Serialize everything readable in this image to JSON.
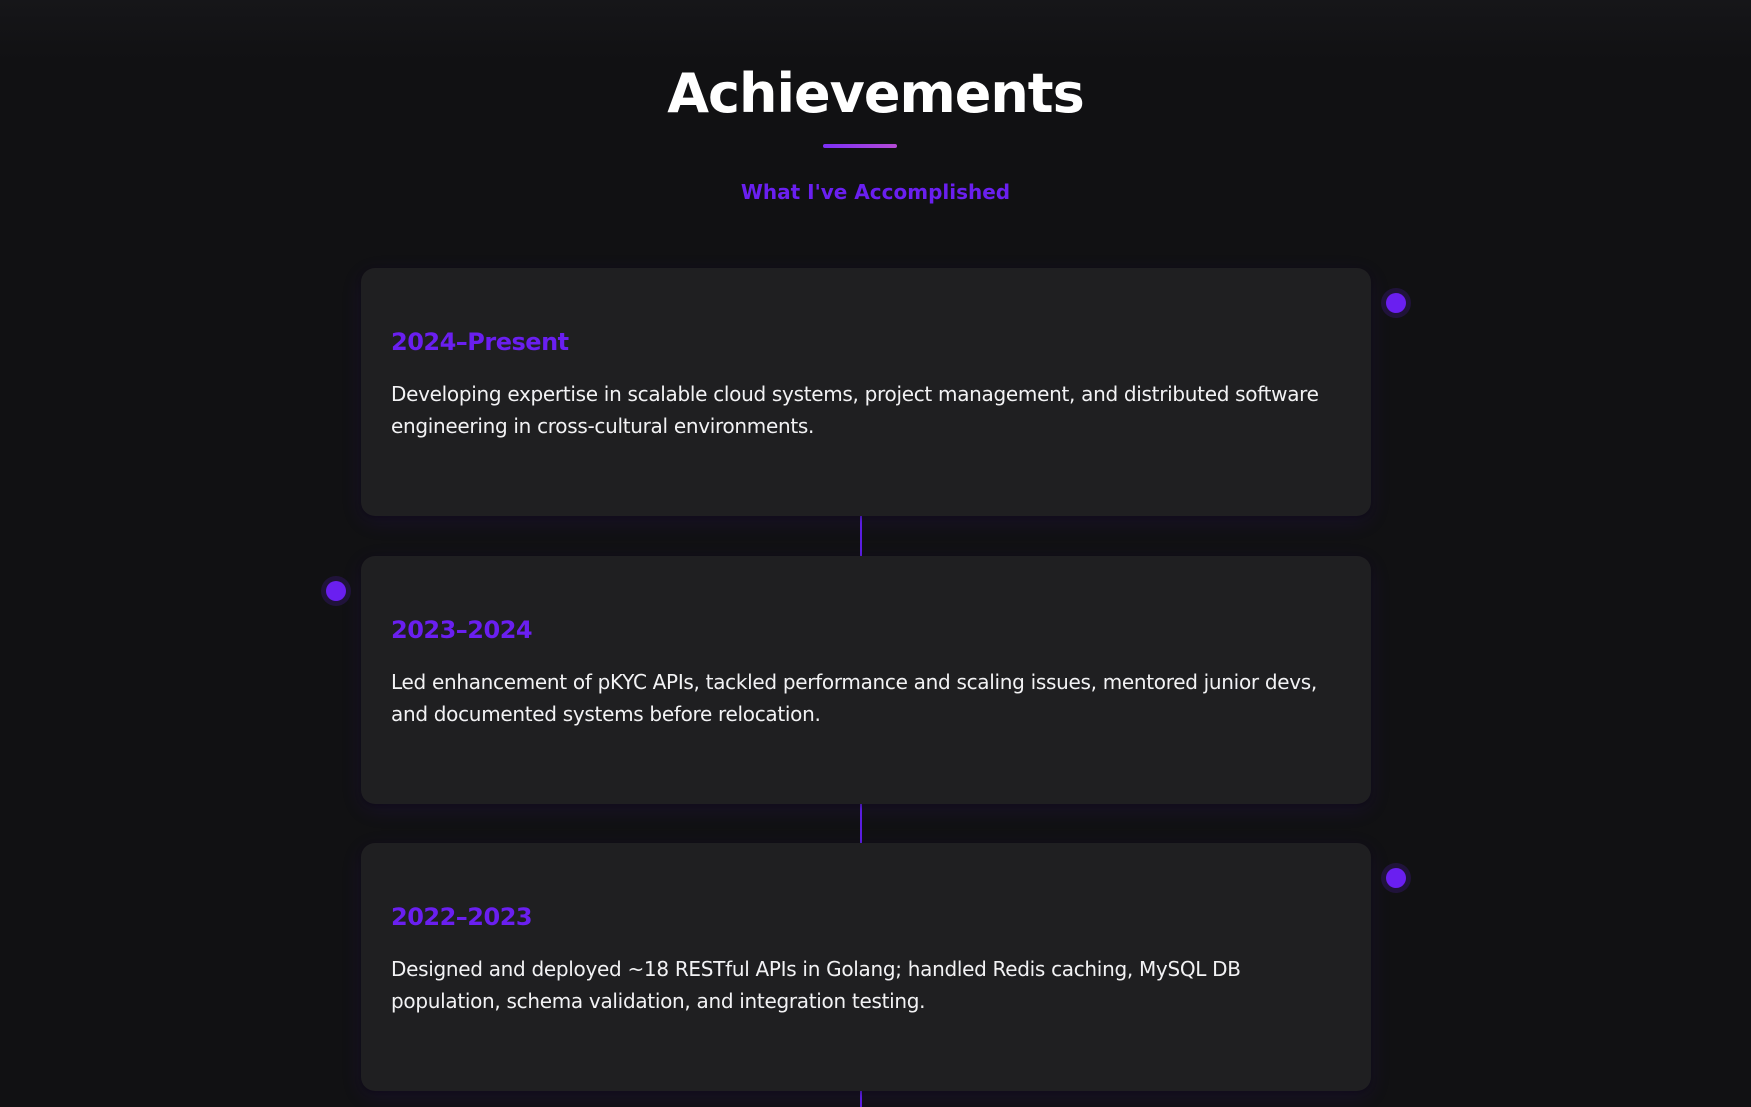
{
  "section": {
    "title": "Achievements",
    "subtitle": "What I've Accomplished"
  },
  "timeline": [
    {
      "year": "2024–Present",
      "text": "Developing expertise in scalable cloud systems, project management, and distributed software engineering in cross-cultural environments.",
      "dot_side": "right"
    },
    {
      "year": "2023–2024",
      "text": "Led enhancement of pKYC APIs, tackled performance and scaling issues, mentored junior devs, and documented systems before relocation.",
      "dot_side": "left"
    },
    {
      "year": "2022–2023",
      "text": "Designed and deployed ~18 RESTful APIs in Golang; handled Redis caching, MySQL DB population, schema validation, and integration testing.",
      "dot_side": "right"
    }
  ],
  "colors": {
    "accent": "#6a1ff0",
    "background": "#111113",
    "card": "#1f1f21",
    "text": "#ffffff"
  }
}
